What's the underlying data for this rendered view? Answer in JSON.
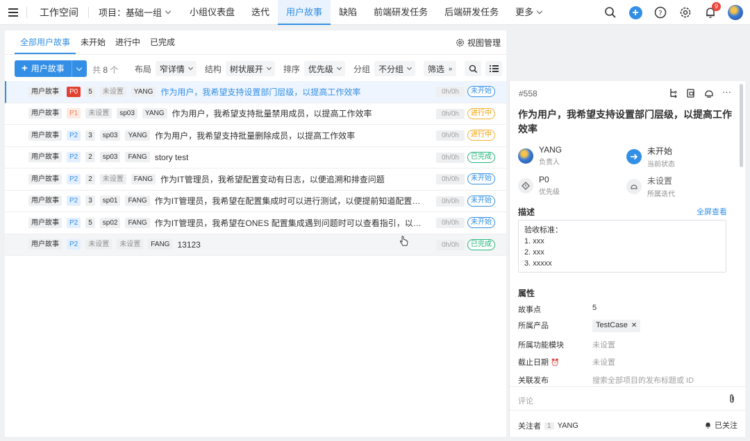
{
  "topbar": {
    "workspace_title": "工作空间",
    "project_label": "项目：基础一组",
    "tabs": [
      {
        "label": "小组仪表盘"
      },
      {
        "label": "迭代"
      },
      {
        "label": "用户故事",
        "active": true
      },
      {
        "label": "缺陷"
      },
      {
        "label": "前端研发任务"
      },
      {
        "label": "后端研发任务"
      }
    ],
    "more_label": "更多",
    "notification_count": "9"
  },
  "subtabs": [
    {
      "label": "全部用户故事",
      "active": true
    },
    {
      "label": "未开始"
    },
    {
      "label": "进行中"
    },
    {
      "label": "已完成"
    }
  ],
  "view_management": "视图管理",
  "toolbar": {
    "add_label": "用户故事",
    "count_prefix": "共",
    "count_value": "8",
    "count_suffix": "个",
    "layout_label": "布局",
    "layout_value": "窄详情",
    "structure_label": "结构",
    "structure_value": "树状展开",
    "sort_label": "排序",
    "sort_value": "优先级",
    "group_label": "分组",
    "group_value": "不分组",
    "filter_label": "筛选"
  },
  "rows": [
    {
      "type": "用户故事",
      "priority": "P0",
      "points": "5",
      "sprint": "未设置",
      "owner": "YANG",
      "title": "作为用户，我希望支持设置部门层级，以提高工作效率",
      "time": "0h/0h",
      "status": "未开始",
      "status_kind": "notstart"
    },
    {
      "type": "用户故事",
      "priority": "P1",
      "points": "未设置",
      "sprint": "sp03",
      "owner": "YANG",
      "title": "作为用户，我希望支持批量禁用成员，以提高工作效率",
      "time": "0h/0h",
      "status": "进行中",
      "status_kind": "progress"
    },
    {
      "type": "用户故事",
      "priority": "P2",
      "points": "3",
      "sprint": "sp03",
      "owner": "YANG",
      "title": "作为用户，我希望支持批量删除成员，以提高工作效率",
      "time": "0h/0h",
      "status": "进行中",
      "status_kind": "progress"
    },
    {
      "type": "用户故事",
      "priority": "P2",
      "points": "2",
      "sprint": "sp03",
      "owner": "FANG",
      "title": "story test",
      "time": "0h/0h",
      "status": "已完成",
      "status_kind": "done"
    },
    {
      "type": "用户故事",
      "priority": "P2",
      "points": "2",
      "sprint": "未设置",
      "owner": "FANG",
      "title": "作为IT管理员，我希望配置变动有日志，以便追溯和排查问题",
      "time": "0h/0h",
      "status": "未开始",
      "status_kind": "notstart"
    },
    {
      "type": "用户故事",
      "priority": "P2",
      "points": "3",
      "sprint": "sp01",
      "owner": "FANG",
      "title": "作为IT管理员，我希望在配置集成时可以进行测试，以便提前知道配置有没有问题...",
      "time": "0h/0h",
      "status": "未开始",
      "status_kind": "notstart"
    },
    {
      "type": "用户故事",
      "priority": "P2",
      "points": "5",
      "sprint": "sp02",
      "owner": "FANG",
      "title": "作为IT管理员，我希望在ONES 配置集成遇到问题时可以查看指引，以便快速解决...",
      "time": "0h/0h",
      "status": "未开始",
      "status_kind": "notstart"
    },
    {
      "type": "用户故事",
      "priority": "P2",
      "points": "未设置",
      "sprint": "未设置",
      "owner": "FANG",
      "title": "13123",
      "time": "0h/0h",
      "status": "已完成",
      "status_kind": "done"
    }
  ],
  "detail": {
    "id": "#558",
    "title": "作为用户，我希望支持设置部门层级，以提高工作效率",
    "assignee": {
      "value": "YANG",
      "label": "负责人"
    },
    "state": {
      "value": "未开始",
      "label": "当前状态"
    },
    "priority": {
      "value": "P0",
      "label": "优先级"
    },
    "sprint": {
      "value": "未设置",
      "label": "所属迭代"
    },
    "desc_title": "描述",
    "fullscreen_label": "全屏查看",
    "desc_lines": [
      "验收标准：",
      "1. xxx",
      "2. xxx",
      "3. xxxxx"
    ],
    "props_title": "属性",
    "props": [
      {
        "label": "故事点",
        "value": "5"
      },
      {
        "label": "所属产品",
        "value": "TestCase"
      },
      {
        "label": "所属功能模块",
        "value": "未设置"
      },
      {
        "label": "截止日期",
        "value": "未设置"
      },
      {
        "label": "关联发布",
        "value": "搜索全部项目的发布标题或 ID"
      }
    ],
    "comment_placeholder": "评论",
    "followers_label": "关注者",
    "followers_count": "1",
    "followers_name": "YANG",
    "followed_label": "已关注"
  },
  "colors": {
    "accent": "#338fe5",
    "p0": "#e24130",
    "done": "#21b67a",
    "progress": "#f0a000"
  }
}
